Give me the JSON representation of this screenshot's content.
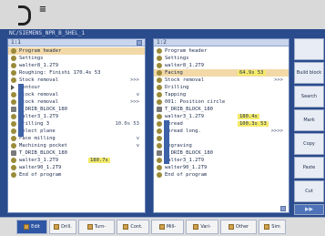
{
  "logo": {
    "glyph": "≡"
  },
  "window": {
    "title": "NC/SIEMENS_NPR_B_SHEL_1"
  },
  "left_panel": {
    "header": "1:1",
    "rows": [
      {
        "icon": "circle",
        "label": "Program header",
        "value": "",
        "selected": true
      },
      {
        "icon": "circle",
        "label": "Settings",
        "value": ""
      },
      {
        "icon": "circle",
        "label": "walter8_1.2T9",
        "value": ""
      },
      {
        "icon": "circle",
        "label": "Roughing: Finishi 170.4s 53",
        "value": ""
      },
      {
        "icon": "circle",
        "label": "Stock removal",
        "value": ">>>"
      },
      {
        "icon": "tri",
        "label": "Contour",
        "value": ""
      },
      {
        "icon": "circle",
        "label": "Stock removal",
        "value": "v"
      },
      {
        "icon": "circle",
        "label": "Stock removal",
        "value": ">>>"
      },
      {
        "icon": "sq",
        "label": "T_DRIB_BLOCK_180",
        "value": ""
      },
      {
        "icon": "circle",
        "label": "walter3_1.2T9",
        "value": ""
      },
      {
        "icon": "circle",
        "label": "Drilling 3",
        "value": "10.0s 53"
      },
      {
        "icon": "circle",
        "label": "Select plane",
        "value": ""
      },
      {
        "icon": "circle",
        "label": "Face milling",
        "value": "v"
      },
      {
        "icon": "circle",
        "label": "Machining pocket",
        "value": "v"
      },
      {
        "icon": "sq",
        "label": "T_DRIB_BLOCK_180",
        "value": ""
      },
      {
        "icon": "circle",
        "label": "walter3_1.2T9",
        "value": "",
        "highlight": "180.7s"
      },
      {
        "icon": "circle",
        "label": "walter90_1.2T9",
        "value": ""
      },
      {
        "icon": "circle",
        "label": "End of program",
        "value": ""
      }
    ]
  },
  "right_panel": {
    "header": "1:2",
    "rows": [
      {
        "icon": "circle",
        "label": "Program header",
        "value": ""
      },
      {
        "icon": "circle",
        "label": "Settings",
        "value": ""
      },
      {
        "icon": "circle",
        "label": "walter8_1.2T9",
        "value": ""
      },
      {
        "icon": "circle",
        "label": "Facing",
        "value": "",
        "highlight": "64.9s 53",
        "selected": true
      },
      {
        "icon": "circle",
        "label": "Stock removal",
        "value": ">>>"
      },
      {
        "icon": "circle",
        "label": "Drilling",
        "value": ""
      },
      {
        "icon": "circle",
        "label": "Tapping",
        "value": ""
      },
      {
        "icon": "circle",
        "label": "001: Position circle",
        "value": ""
      },
      {
        "icon": "sq",
        "label": "T_DRIB_BLOCK_180",
        "value": ""
      },
      {
        "icon": "circle",
        "label": "walter3_1.2T9",
        "value": "",
        "highlight": "180.4s"
      },
      {
        "icon": "circle",
        "label": "Thread",
        "value": "",
        "highlight": "100.3s 53"
      },
      {
        "icon": "circle",
        "label": "Thread long.",
        "value": ">>>>"
      },
      {
        "icon": "circle",
        "label": "E",
        "value": ""
      },
      {
        "icon": "circle",
        "label": "Engraving",
        "value": ""
      },
      {
        "icon": "sq",
        "label": "T_DRIB_BLOCK_180",
        "value": ""
      },
      {
        "icon": "circle",
        "label": "walter3_1.2T9",
        "value": ""
      },
      {
        "icon": "circle",
        "label": "walter90_1.2T9",
        "value": ""
      },
      {
        "icon": "circle",
        "label": "End of program",
        "value": ""
      }
    ]
  },
  "softkeys": {
    "k1": "Build block",
    "k2": "Search",
    "k3": "Mark",
    "k4": "Copy",
    "k5": "Paste",
    "k6": "Cut",
    "more": "▸▸"
  },
  "bottom_keys": [
    {
      "label": "Edit",
      "active": true
    },
    {
      "label": "Drill.",
      "active": false
    },
    {
      "label": "Turn-",
      "active": false
    },
    {
      "label": "Cont.",
      "active": false
    },
    {
      "label": "Mill-",
      "active": false
    },
    {
      "label": "Vari-",
      "active": false
    },
    {
      "label": "Other",
      "active": false
    },
    {
      "label": "Sim",
      "active": false
    }
  ]
}
